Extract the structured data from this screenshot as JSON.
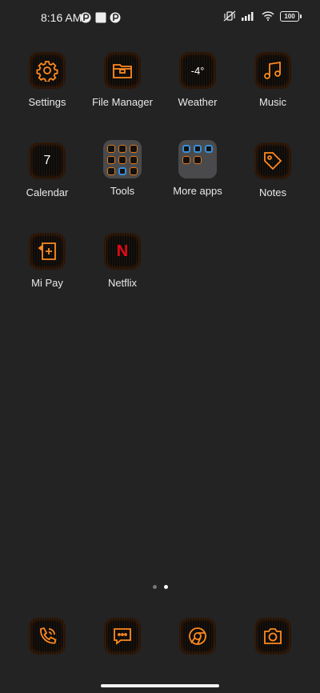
{
  "status_bar": {
    "time": "8:16 AM",
    "battery": "100"
  },
  "apps": [
    {
      "label": "Settings",
      "icon": "gear-icon"
    },
    {
      "label": "File Manager",
      "icon": "folder-icon"
    },
    {
      "label": "Weather",
      "icon": "weather-icon",
      "value": "-4°"
    },
    {
      "label": "Music",
      "icon": "music-note-icon"
    },
    {
      "label": "Calendar",
      "icon": "calendar-icon",
      "value": "7"
    },
    {
      "label": "Tools",
      "icon": "tools-folder"
    },
    {
      "label": "More apps",
      "icon": "more-apps-folder"
    },
    {
      "label": "Notes",
      "icon": "tag-icon"
    },
    {
      "label": "Mi Pay",
      "icon": "mi-pay-icon"
    },
    {
      "label": "Netflix",
      "icon": "netflix-icon",
      "value": "N"
    }
  ],
  "dock": [
    {
      "icon": "phone-icon"
    },
    {
      "icon": "message-icon"
    },
    {
      "icon": "browser-icon"
    },
    {
      "icon": "camera-icon"
    }
  ],
  "pages": {
    "count": 2,
    "active": 2
  },
  "colors": {
    "accent": "#ff8a1f",
    "background": "#232324",
    "netflix": "#e50914"
  }
}
